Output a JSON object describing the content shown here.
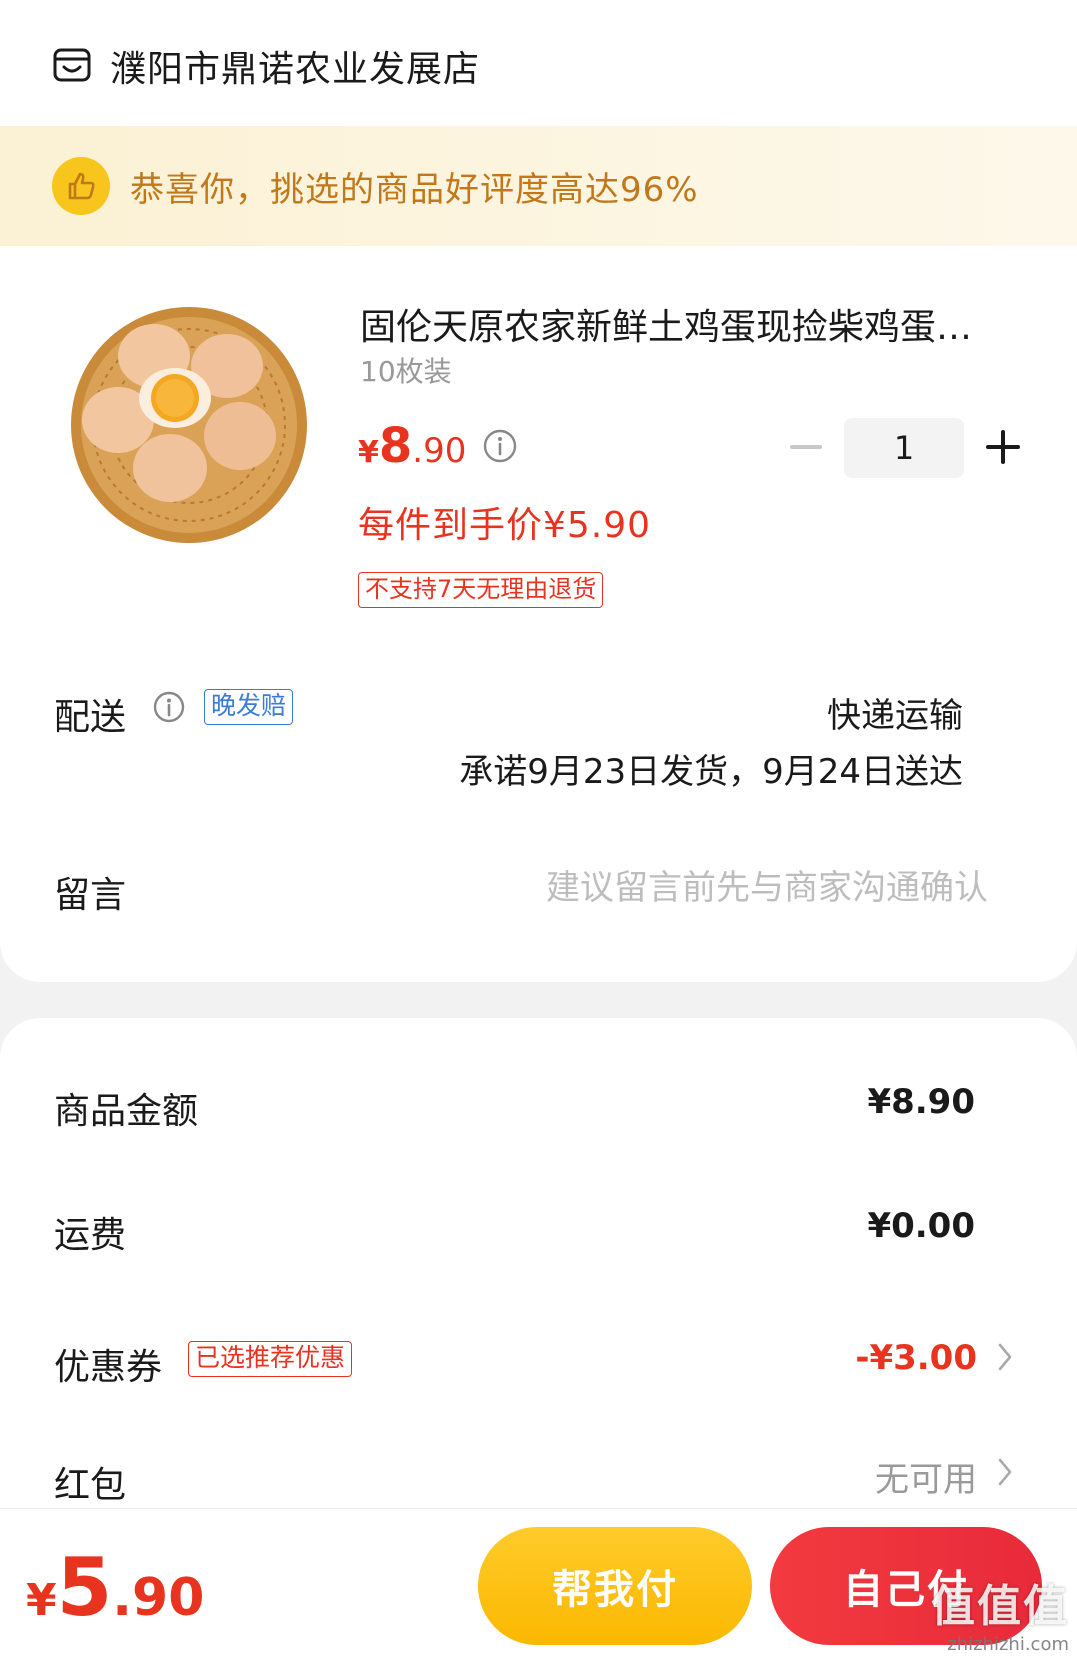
{
  "shop": {
    "name": "濮阳市鼎诺农业发展店",
    "icon": "shop-icon"
  },
  "banner": {
    "text": "恭喜你，挑选的商品好评度高达96%",
    "icon": "thumbs-up-icon"
  },
  "product": {
    "title": "固伦天原农家新鲜土鸡蛋现捡柴鸡蛋…",
    "spec": "10枚装",
    "price_yen": "¥",
    "price_int": "8",
    "price_dec": ".90",
    "quantity": "1",
    "deal_price": "每件到手价¥5.90",
    "return_tag": "不支持7天无理由退货"
  },
  "delivery": {
    "label": "配送",
    "late_tag": "晚发赔",
    "method": "快递运输",
    "promise": "承诺9月23日发货，9月24日送达"
  },
  "message": {
    "label": "留言",
    "placeholder": "建议留言前先与商家沟通确认"
  },
  "summary": {
    "goods_label": "商品金额",
    "goods_value": "¥8.90",
    "shipping_label": "运费",
    "shipping_value": "¥0.00",
    "coupon_label": "优惠券",
    "coupon_tag": "已选推荐优惠",
    "coupon_value": "-¥3.00",
    "redpacket_label": "红包",
    "redpacket_value": "无可用"
  },
  "footer": {
    "total_yen": "¥",
    "total_int": "5",
    "total_dec": ".90",
    "help_pay_label": "帮我付",
    "self_pay_label": "自己付"
  },
  "watermark": {
    "mark": "值值值",
    "url": "zhizhizhi.com"
  },
  "colors": {
    "accent_red": "#e8331f",
    "banner_text": "#c0781a",
    "help_pay_yellow": "#fbb800",
    "self_pay_red": "#f23a3f",
    "late_tag_blue": "#3a7bd5"
  }
}
